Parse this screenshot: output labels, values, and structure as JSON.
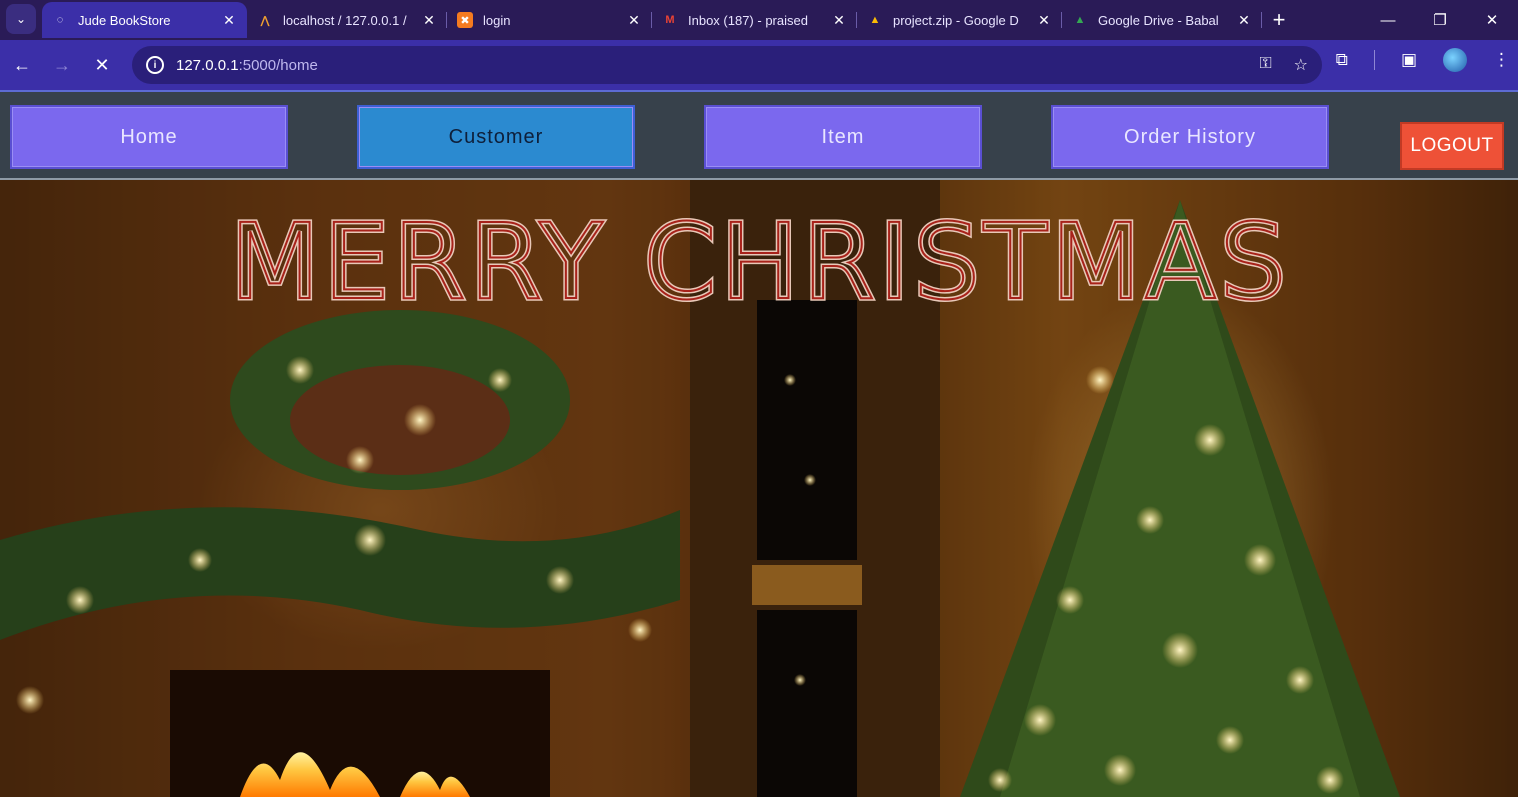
{
  "browser": {
    "tabs": [
      {
        "title": "Jude BookStore",
        "icon": "page-icon",
        "active": true
      },
      {
        "title": "localhost / 127.0.0.1 /",
        "icon": "phpmyadmin-icon",
        "active": false
      },
      {
        "title": "login",
        "icon": "xampp-icon",
        "active": false
      },
      {
        "title": "Inbox (187) - praised",
        "icon": "gmail-icon",
        "active": false
      },
      {
        "title": "project.zip - Google D",
        "icon": "google-drive-icon",
        "active": false
      },
      {
        "title": "Google Drive - Babal",
        "icon": "google-drive-icon",
        "active": false
      }
    ],
    "url_host": "127.0.0.1",
    "url_path": ":5000/home"
  },
  "nav": {
    "home": "Home",
    "customer": "Customer",
    "item": "Item",
    "order_history": "Order History",
    "logout": "LOGOUT"
  },
  "hero": {
    "banner_text": "MERRY CHRISTMAS",
    "image": "christmas-fireplace-tree-photo"
  },
  "colors": {
    "nav_button": "#7b68ee",
    "nav_active": "#2b8ad0",
    "logout": "#ee5137",
    "navbar_bg": "#37414b",
    "browser_accent": "#3b2fa8"
  }
}
